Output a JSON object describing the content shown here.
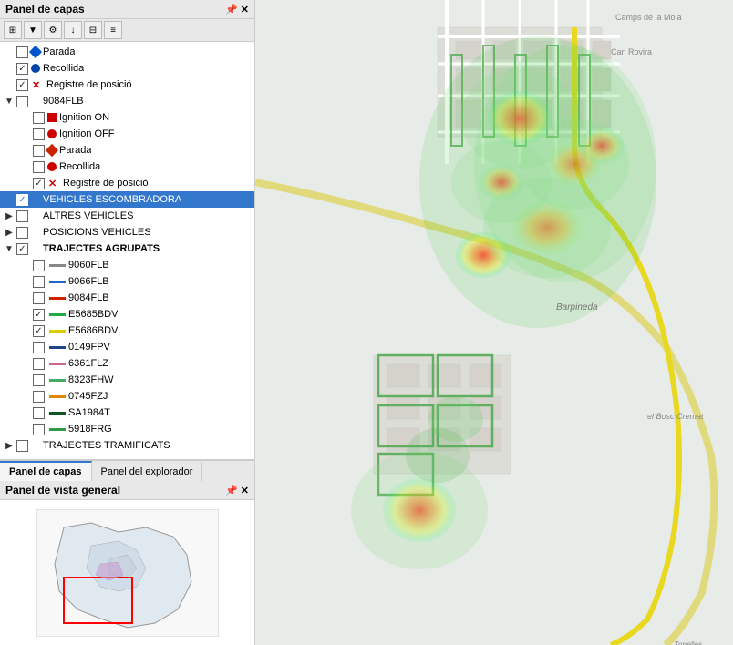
{
  "leftPanel": {
    "layersPanel": {
      "title": "Panel de capas",
      "toolbar": [
        "move-up",
        "filter",
        "settings",
        "down-arrow",
        "table",
        "more"
      ],
      "items": [
        {
          "id": "parada1",
          "indent": 0,
          "expander": "",
          "checked": false,
          "icon": "diamond-blue",
          "label": "Parada"
        },
        {
          "id": "recollida1",
          "indent": 0,
          "expander": "",
          "checked": true,
          "icon": "circle-blue",
          "label": "Recollida"
        },
        {
          "id": "registre1",
          "indent": 0,
          "expander": "",
          "checked": true,
          "icon": "x-red",
          "label": "Registre de posició"
        },
        {
          "id": "9084FLB",
          "indent": 0,
          "expander": "v",
          "checked": false,
          "icon": null,
          "label": "9084FLB"
        },
        {
          "id": "ignition-on",
          "indent": 1,
          "expander": "",
          "checked": false,
          "icon": "square-red",
          "label": "Ignition ON"
        },
        {
          "id": "ignition-off",
          "indent": 1,
          "expander": "",
          "checked": false,
          "icon": "circle-red",
          "label": "Ignition OFF"
        },
        {
          "id": "parada2",
          "indent": 1,
          "expander": "",
          "checked": false,
          "icon": "diamond-red",
          "label": "Parada"
        },
        {
          "id": "recollida2",
          "indent": 1,
          "expander": "",
          "checked": false,
          "icon": "circle-red",
          "label": "Recollida"
        },
        {
          "id": "registre2",
          "indent": 1,
          "expander": "",
          "checked": true,
          "icon": "x-red",
          "label": "Registre de posició"
        },
        {
          "id": "vehicles-escombr",
          "indent": 0,
          "expander": "",
          "checked": true,
          "icon": null,
          "label": "VEHICLES ESCOMBRADORA",
          "selected": true
        },
        {
          "id": "altres-vehicles",
          "indent": 0,
          "expander": ">",
          "checked": false,
          "icon": null,
          "label": "ALTRES VEHICLES"
        },
        {
          "id": "posicions-vehicles",
          "indent": 0,
          "expander": ">",
          "checked": false,
          "icon": null,
          "label": "POSICIONS VEHICLES"
        },
        {
          "id": "trajectes-agrupats",
          "indent": 0,
          "expander": "v",
          "checked": true,
          "icon": null,
          "label": "TRAJECTES AGRUPATS",
          "bold": true
        },
        {
          "id": "t9060FLB",
          "indent": 1,
          "expander": "",
          "checked": false,
          "icon": "line-gray",
          "label": "9060FLB"
        },
        {
          "id": "t9066FLB",
          "indent": 1,
          "expander": "",
          "checked": false,
          "icon": "line-blue",
          "label": "9066FLB"
        },
        {
          "id": "t9084FLB",
          "indent": 1,
          "expander": "",
          "checked": false,
          "icon": "line-red",
          "label": "9084FLB"
        },
        {
          "id": "tE5685BDV",
          "indent": 1,
          "expander": "",
          "checked": true,
          "icon": "line-green",
          "label": "E5685BDV"
        },
        {
          "id": "tE5686BDV",
          "indent": 1,
          "expander": "",
          "checked": true,
          "icon": "line-yellow",
          "label": "E5686BDV"
        },
        {
          "id": "t0149FPV",
          "indent": 1,
          "expander": "",
          "checked": false,
          "icon": "line-darkblue",
          "label": "0149FPV"
        },
        {
          "id": "t6361FLZ",
          "indent": 1,
          "expander": "",
          "checked": false,
          "icon": "line-pink",
          "label": "6361FLZ"
        },
        {
          "id": "t8323FHW",
          "indent": 1,
          "expander": "",
          "checked": false,
          "icon": "line-green2",
          "label": "8323FHW"
        },
        {
          "id": "t0745FZJ",
          "indent": 1,
          "expander": "",
          "checked": false,
          "icon": "line-orange",
          "label": "0745FZJ"
        },
        {
          "id": "tSA1984T",
          "indent": 1,
          "expander": "",
          "checked": false,
          "icon": "line-darkgreen",
          "label": "SA1984T"
        },
        {
          "id": "t5918FRG",
          "indent": 1,
          "expander": "",
          "checked": false,
          "icon": "line-green3",
          "label": "5918FRG"
        },
        {
          "id": "trajectes-tramificats",
          "indent": 0,
          "expander": ">",
          "checked": false,
          "icon": null,
          "label": "TRAJECTES TRAMIFICATS"
        }
      ]
    },
    "tabs": [
      {
        "id": "tab-capas",
        "label": "Panel de capas",
        "active": true
      },
      {
        "id": "tab-explorador",
        "label": "Panel del explorador",
        "active": false
      }
    ],
    "overviewPanel": {
      "title": "Panel de vista general"
    }
  },
  "iconColors": {
    "diamond-blue": "#0055cc",
    "circle-blue": "#0044aa",
    "x-red": "#cc0000",
    "square-red": "#cc0000",
    "circle-red": "#cc0000",
    "diamond-red": "#cc2200",
    "line-gray": "#888888",
    "line-blue": "#2266cc",
    "line-red": "#cc2200",
    "line-green": "#22aa44",
    "line-yellow": "#ddcc00",
    "line-darkblue": "#224488",
    "line-pink": "#cc6688",
    "line-green2": "#44aa66",
    "line-orange": "#dd8800",
    "line-darkgreen": "#115522",
    "line-green3": "#339944"
  }
}
